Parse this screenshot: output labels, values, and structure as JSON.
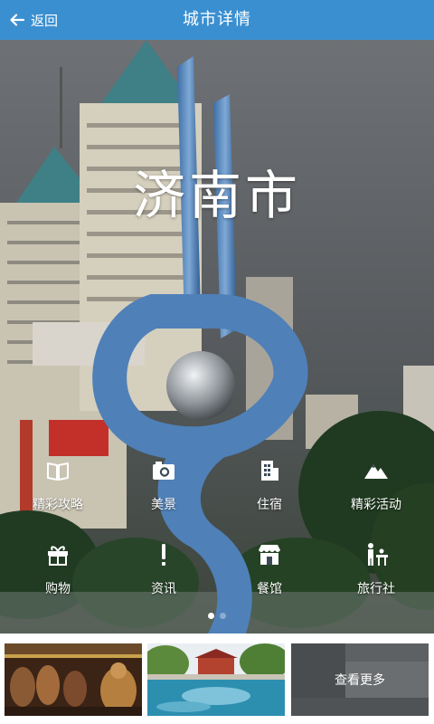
{
  "header": {
    "back_label": "返回",
    "title": "城市详情",
    "background": "#3a8fd0"
  },
  "hero": {
    "city_name": "济南市",
    "menu_items": [
      {
        "label": "精彩攻略",
        "icon": "open-book-icon"
      },
      {
        "label": "美景",
        "icon": "camera-icon"
      },
      {
        "label": "住宿",
        "icon": "hotel-building-icon"
      },
      {
        "label": "精彩活动",
        "icon": "mountain-icon"
      },
      {
        "label": "购物",
        "icon": "gift-box-icon"
      },
      {
        "label": "资讯",
        "icon": "exclamation-icon"
      },
      {
        "label": "餐馆",
        "icon": "storefront-icon"
      },
      {
        "label": "旅行社",
        "icon": "travel-agent-icon"
      }
    ],
    "carousel": {
      "page_count": 2,
      "active_index": 0
    }
  },
  "thumbnails": {
    "items": [
      {
        "name": "temple-statues-photo"
      },
      {
        "name": "spring-pavilion-photo"
      }
    ],
    "more_label": "查看更多"
  }
}
